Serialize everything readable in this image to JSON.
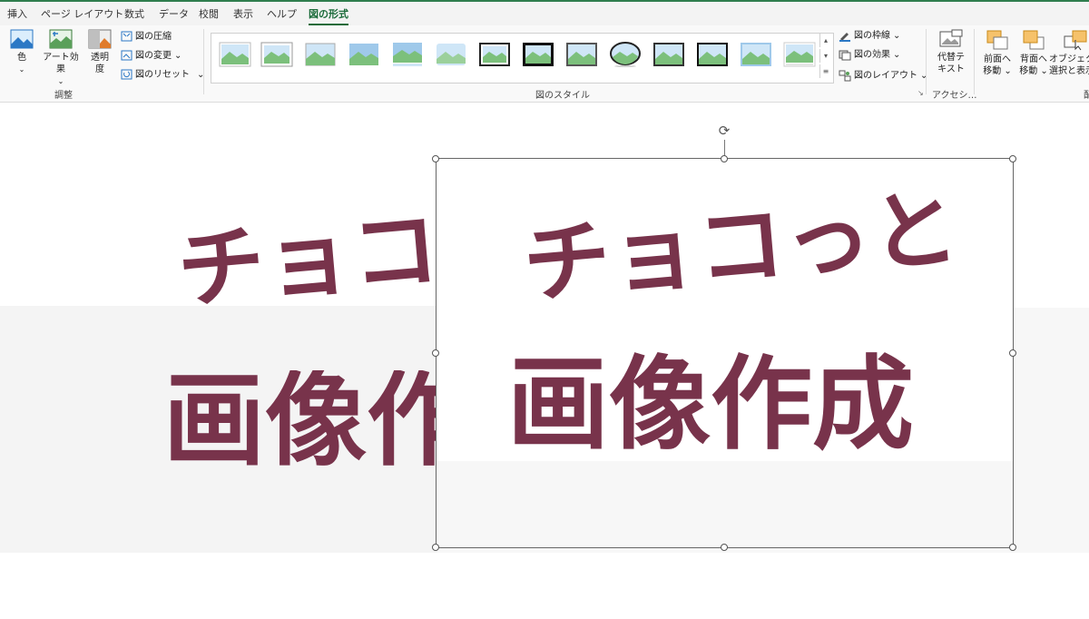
{
  "tabs": [
    {
      "label": "挿入",
      "active": false
    },
    {
      "label": "ページ レイアウト",
      "active": false
    },
    {
      "label": "数式",
      "active": false
    },
    {
      "label": "データ",
      "active": false
    },
    {
      "label": "校閲",
      "active": false
    },
    {
      "label": "表示",
      "active": false
    },
    {
      "label": "ヘルプ",
      "active": false
    },
    {
      "label": "図の形式",
      "active": true
    }
  ],
  "ribbon": {
    "adjust": {
      "color": "色",
      "art_effect": "アート効果",
      "transparency_1": "透明",
      "transparency_2": "度",
      "compress": "図の圧縮",
      "change": "図の変更",
      "reset": "図のリセット",
      "group_label": "調整"
    },
    "styles": {
      "group_label": "図のスタイル",
      "border": "図の枠線",
      "effects": "図の効果",
      "layout": "図のレイアウト"
    },
    "accessibility": {
      "alt_text_1": "代替テ",
      "alt_text_2": "キスト",
      "group_label": "アクセシ…"
    },
    "arrange": {
      "bring_forward_1": "前面へ",
      "bring_forward_2": "移動",
      "send_backward_1": "背面へ",
      "send_backward_2": "移動",
      "selection_1": "オブジェクト",
      "selection_2": "選択と表示"
    }
  },
  "canvas": {
    "line1": "チョコっと",
    "line2": "画像作成",
    "text_color": "#78334b"
  },
  "colors": {
    "accent": "#1b6b3a",
    "text_maroon": "#78334b"
  }
}
